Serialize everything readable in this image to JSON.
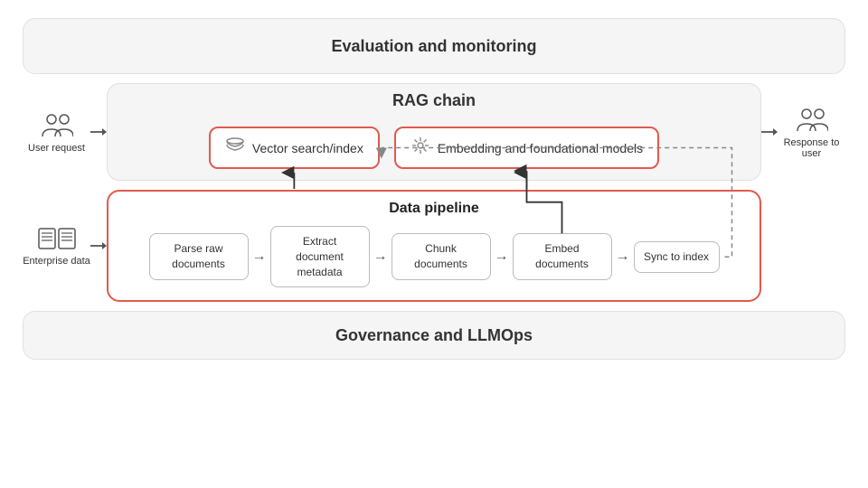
{
  "diagram": {
    "eval_label": "Evaluation and monitoring",
    "rag_label": "RAG chain",
    "vector_search_label": "Vector search/index",
    "embedding_label": "Embedding and foundational models",
    "data_pipeline_label": "Data pipeline",
    "governance_label": "Governance and LLMOps",
    "pipeline_steps": [
      {
        "id": "parse",
        "text": "Parse raw documents"
      },
      {
        "id": "extract",
        "text": "Extract document metadata"
      },
      {
        "id": "chunk",
        "text": "Chunk documents"
      },
      {
        "id": "embed",
        "text": "Embed documents"
      },
      {
        "id": "sync",
        "text": "Sync to index"
      }
    ],
    "user_request_label": "User request",
    "response_label": "Response to user",
    "user_icon": "👤",
    "response_icon": "👤",
    "enterprise_label": "Enterprise data",
    "vector_icon": "🗂",
    "embedding_icon": "✳"
  }
}
